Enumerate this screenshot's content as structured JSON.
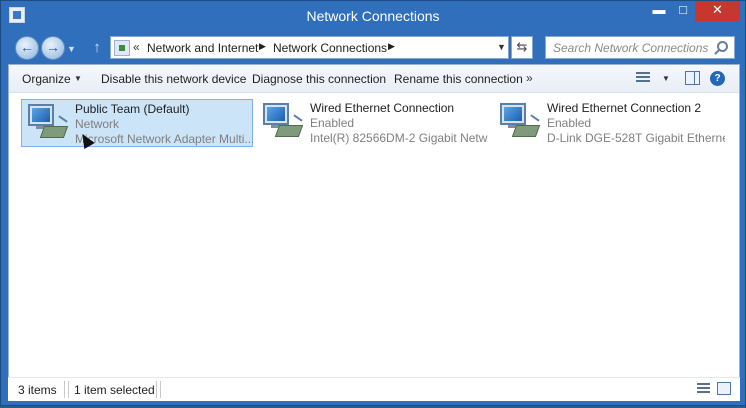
{
  "window": {
    "title": "Network Connections",
    "controls": {
      "minimize": "▬",
      "maximize": "□",
      "close": "✕"
    }
  },
  "nav": {
    "back_icon": "back-arrow-icon",
    "forward_icon": "forward-arrow-icon",
    "up_icon": "up-arrow-icon",
    "address": {
      "chevron": "«",
      "crumbs": [
        "Network and Internet",
        "Network Connections"
      ]
    },
    "search": {
      "placeholder": "Search Network Connections"
    }
  },
  "toolbar": {
    "organize": "Organize",
    "disable": "Disable this network device",
    "diagnose": "Diagnose this connection",
    "rename": "Rename this connection",
    "more": "»"
  },
  "items": [
    {
      "name": "Public Team (Default)",
      "status": "Network",
      "device": "Microsoft Network Adapter Multi...",
      "selected": true
    },
    {
      "name": "Wired Ethernet Connection",
      "status": "Enabled",
      "device": "Intel(R) 82566DM-2 Gigabit Netw...",
      "selected": false
    },
    {
      "name": "Wired Ethernet Connection 2",
      "status": "Enabled",
      "device": "D-Link DGE-528T Gigabit Ethernet...",
      "selected": false
    }
  ],
  "status": {
    "items_count": "3 items",
    "selected_count": "1 item selected"
  },
  "colors": {
    "frame": "#2f6fbb",
    "selection": "#cce4f7",
    "close": "#c7372f"
  }
}
